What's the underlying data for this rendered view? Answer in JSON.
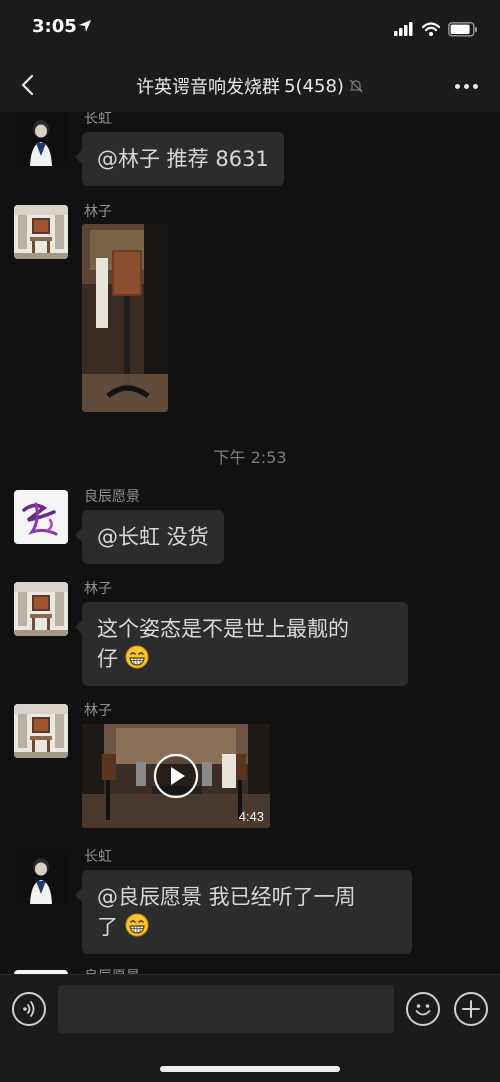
{
  "status_bar": {
    "time": "3:05"
  },
  "header": {
    "title": "许英谔音响发烧群",
    "member_count": "5(458)"
  },
  "messages": [
    {
      "type": "text",
      "sender": "长虹",
      "avatar": "person-avatar",
      "text": "@林子 推荐 8631"
    },
    {
      "type": "image",
      "sender": "林子",
      "avatar": "room-avatar",
      "image": "speaker-on-stand-photo"
    },
    {
      "type": "time",
      "text": "下午 2:53"
    },
    {
      "type": "text",
      "sender": "良辰愿景",
      "avatar": "calligraphy-avatar",
      "text": "@长虹 没货"
    },
    {
      "type": "text",
      "sender": "林子",
      "avatar": "room-avatar",
      "text_line1": "这个姿态是不是世上最靓的",
      "text_line2": "仔",
      "emoji": "grinning-emoji"
    },
    {
      "type": "video",
      "sender": "林子",
      "avatar": "room-avatar",
      "duration": "4:43"
    },
    {
      "type": "text",
      "sender": "长虹",
      "avatar": "person-avatar",
      "text_line1": "@良辰愿景 我已经听了一周",
      "text_line2": "了",
      "emoji": "grinning-emoji"
    },
    {
      "type": "partial",
      "sender": "良辰愿景"
    }
  ],
  "input_bar": {
    "placeholder": ""
  },
  "colors": {
    "background": "#111111",
    "bubble": "#2c2c2c",
    "bar": "#1b1b1b",
    "text": "#d8d8d8",
    "meta": "#8f8f8f"
  }
}
